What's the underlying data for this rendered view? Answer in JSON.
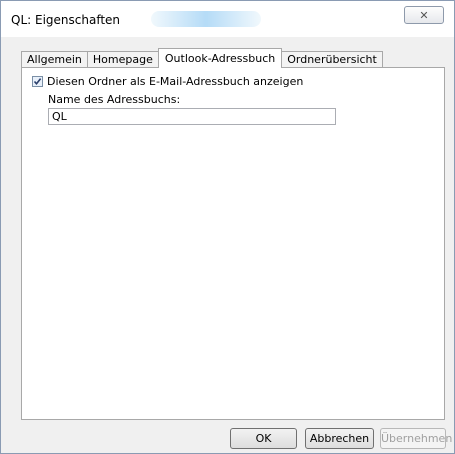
{
  "window": {
    "title": "QL: Eigenschaften",
    "close_glyph": "✕"
  },
  "tabs": [
    {
      "label": "Allgemein"
    },
    {
      "label": "Homepage"
    },
    {
      "label": "Outlook-Adressbuch",
      "active": true
    },
    {
      "label": "Ordnerübersicht"
    }
  ],
  "panel": {
    "checkbox_label": "Diesen Ordner als E-Mail-Adressbuch anzeigen",
    "checkbox_checked": true,
    "name_label": "Name des Adressbuchs:",
    "name_value": "QL"
  },
  "buttons": {
    "ok": "OK",
    "cancel": "Abbrechen",
    "apply": "Übernehmen"
  },
  "colors": {
    "dialog_bg": "#f0f0f0",
    "panel_bg": "#ffffff",
    "disabled_text": "#a0a0a0"
  }
}
